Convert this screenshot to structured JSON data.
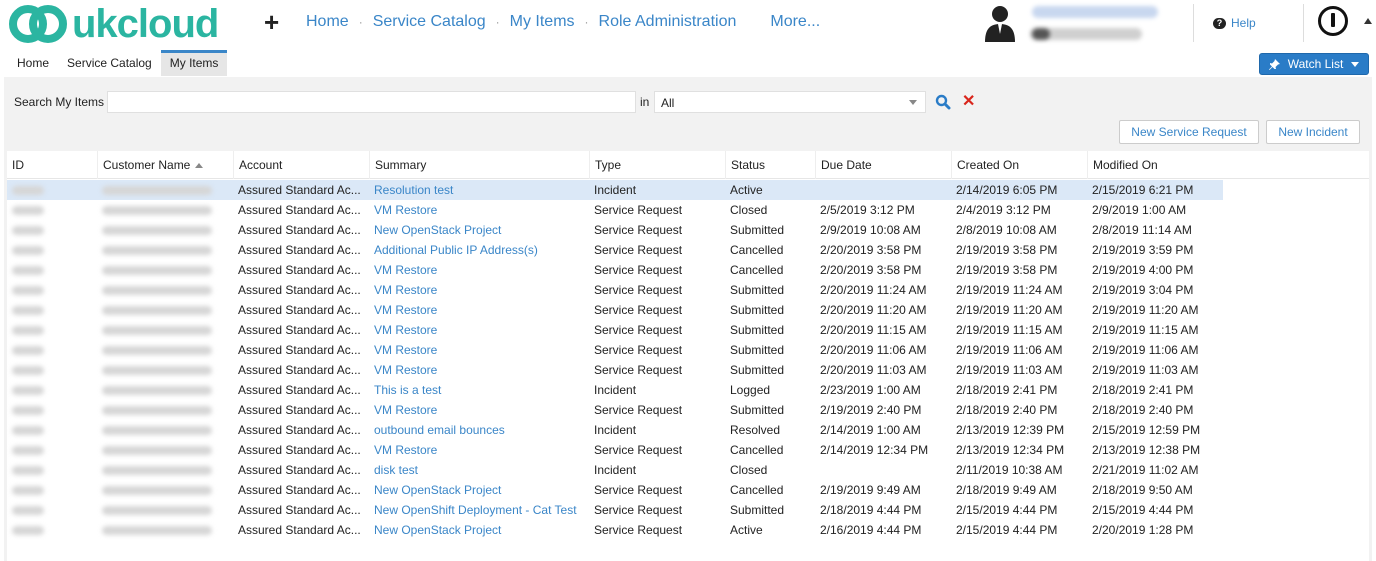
{
  "brand": {
    "name": "ukcloud",
    "color": "#2bb5a1"
  },
  "topnav": {
    "items": [
      "Home",
      "Service Catalog",
      "My Items",
      "Role Administration"
    ],
    "more": "More...",
    "help": "Help"
  },
  "tabs": [
    "Home",
    "Service Catalog",
    "My Items"
  ],
  "watchlist_label": "Watch List",
  "search": {
    "label": "Search My Items",
    "value": "",
    "in_label": "in",
    "scope": "All"
  },
  "buttons": {
    "new_request": "New Service Request",
    "new_incident": "New Incident"
  },
  "colors": {
    "link": "#3a86c8",
    "selected_row": "#dbe8f7",
    "primary_button": "#2a7cc7",
    "clear": "#d9261c"
  },
  "table": {
    "columns": [
      "ID",
      "Customer Name",
      "Account",
      "Summary",
      "Type",
      "Status",
      "Due Date",
      "Created On",
      "Modified On"
    ],
    "sort_column": "Customer Name",
    "rows": [
      {
        "account": "Assured Standard Ac...",
        "summary": "Resolution test",
        "type": "Incident",
        "status": "Active",
        "due": "",
        "created": "2/14/2019 6:05 PM",
        "modified": "2/15/2019 6:21 PM"
      },
      {
        "account": "Assured Standard Ac...",
        "summary": "VM Restore",
        "type": "Service Request",
        "status": "Closed",
        "due": "2/5/2019 3:12 PM",
        "created": "2/4/2019 3:12 PM",
        "modified": "2/9/2019 1:00 AM"
      },
      {
        "account": "Assured Standard Ac...",
        "summary": "New OpenStack Project",
        "type": "Service Request",
        "status": "Submitted",
        "due": "2/9/2019 10:08 AM",
        "created": "2/8/2019 10:08 AM",
        "modified": "2/8/2019 11:14 AM"
      },
      {
        "account": "Assured Standard Ac...",
        "summary": "Additional Public IP Address(s)",
        "type": "Service Request",
        "status": "Cancelled",
        "due": "2/20/2019 3:58 PM",
        "created": "2/19/2019 3:58 PM",
        "modified": "2/19/2019 3:59 PM"
      },
      {
        "account": "Assured Standard Ac...",
        "summary": "VM Restore",
        "type": "Service Request",
        "status": "Cancelled",
        "due": "2/20/2019 3:58 PM",
        "created": "2/19/2019 3:58 PM",
        "modified": "2/19/2019 4:00 PM"
      },
      {
        "account": "Assured Standard Ac...",
        "summary": "VM Restore",
        "type": "Service Request",
        "status": "Submitted",
        "due": "2/20/2019 11:24 AM",
        "created": "2/19/2019 11:24 AM",
        "modified": "2/19/2019 3:04 PM"
      },
      {
        "account": "Assured Standard Ac...",
        "summary": "VM Restore",
        "type": "Service Request",
        "status": "Submitted",
        "due": "2/20/2019 11:20 AM",
        "created": "2/19/2019 11:20 AM",
        "modified": "2/19/2019 11:20 AM"
      },
      {
        "account": "Assured Standard Ac...",
        "summary": "VM Restore",
        "type": "Service Request",
        "status": "Submitted",
        "due": "2/20/2019 11:15 AM",
        "created": "2/19/2019 11:15 AM",
        "modified": "2/19/2019 11:15 AM"
      },
      {
        "account": "Assured Standard Ac...",
        "summary": "VM Restore",
        "type": "Service Request",
        "status": "Submitted",
        "due": "2/20/2019 11:06 AM",
        "created": "2/19/2019 11:06 AM",
        "modified": "2/19/2019 11:06 AM"
      },
      {
        "account": "Assured Standard Ac...",
        "summary": "VM Restore",
        "type": "Service Request",
        "status": "Submitted",
        "due": "2/20/2019 11:03 AM",
        "created": "2/19/2019 11:03 AM",
        "modified": "2/19/2019 11:03 AM"
      },
      {
        "account": "Assured Standard Ac...",
        "summary": "This is a test",
        "type": "Incident",
        "status": "Logged",
        "due": "2/23/2019 1:00 AM",
        "created": "2/18/2019 2:41 PM",
        "modified": "2/18/2019 2:41 PM"
      },
      {
        "account": "Assured Standard Ac...",
        "summary": "VM Restore",
        "type": "Service Request",
        "status": "Submitted",
        "due": "2/19/2019 2:40 PM",
        "created": "2/18/2019 2:40 PM",
        "modified": "2/18/2019 2:40 PM"
      },
      {
        "account": "Assured Standard Ac...",
        "summary": "outbound email bounces",
        "type": "Incident",
        "status": "Resolved",
        "due": "2/14/2019 1:00 AM",
        "created": "2/13/2019 12:39 PM",
        "modified": "2/15/2019 12:59 PM"
      },
      {
        "account": "Assured Standard Ac...",
        "summary": "VM Restore",
        "type": "Service Request",
        "status": "Cancelled",
        "due": "2/14/2019 12:34 PM",
        "created": "2/13/2019 12:34 PM",
        "modified": "2/13/2019 12:38 PM"
      },
      {
        "account": "Assured Standard Ac...",
        "summary": "disk test",
        "type": "Incident",
        "status": "Closed",
        "due": "",
        "created": "2/11/2019 10:38 AM",
        "modified": "2/21/2019 11:02 AM"
      },
      {
        "account": "Assured Standard Ac...",
        "summary": "New OpenStack Project",
        "type": "Service Request",
        "status": "Cancelled",
        "due": "2/19/2019 9:49 AM",
        "created": "2/18/2019 9:49 AM",
        "modified": "2/18/2019 9:50 AM"
      },
      {
        "account": "Assured Standard Ac...",
        "summary": "New OpenShift Deployment - Cat Test",
        "type": "Service Request",
        "status": "Submitted",
        "due": "2/18/2019 4:44 PM",
        "created": "2/15/2019 4:44 PM",
        "modified": "2/15/2019 4:44 PM"
      },
      {
        "account": "Assured Standard Ac...",
        "summary": "New OpenStack Project",
        "type": "Service Request",
        "status": "Active",
        "due": "2/16/2019 4:44 PM",
        "created": "2/15/2019 4:44 PM",
        "modified": "2/20/2019 1:28 PM"
      }
    ]
  }
}
